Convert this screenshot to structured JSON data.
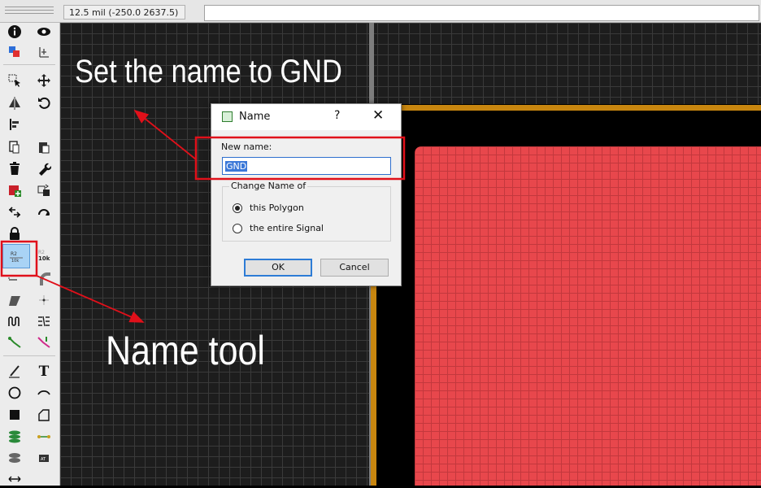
{
  "status": {
    "coordinate": "12.5 mil (-250.0 2637.5)"
  },
  "annotations": {
    "top_text": "Set the name to GND",
    "bottom_text": "Name tool",
    "color": "#e0101a"
  },
  "dialog": {
    "title": "Name",
    "help_glyph": "?",
    "close_glyph": "✕",
    "new_name_label": "New name:",
    "new_name_value": "GND",
    "group_title": "Change Name of",
    "options": [
      {
        "label": "this Polygon",
        "selected": true
      },
      {
        "label": "the entire Signal",
        "selected": false
      }
    ],
    "ok_label": "OK",
    "cancel_label": "Cancel"
  },
  "toolbar": {
    "icons": [
      "info-icon",
      "eye-icon",
      "layer-display-icon",
      "mark-icon",
      "select-icon",
      "move-icon",
      "mirror-icon",
      "rotate-icon",
      "align-icon",
      "copy-icon",
      "paste-icon",
      "delete-icon",
      "wrench-icon",
      "add-icon",
      "replace-icon",
      "swap-icon",
      "optimize-icon",
      "lock-icon",
      "name-tool-icon",
      "value-tool-icon",
      "smash-icon",
      "miter-icon",
      "split-icon",
      "meander-icon",
      "ripup-icon",
      "route-icon",
      "autoroute-icon",
      "line-icon",
      "text-icon",
      "circle-icon",
      "arc-icon",
      "rectangle-icon",
      "polygon-icon",
      "via-icon",
      "signal-icon",
      "hole-icon",
      "attribute-icon",
      "dimension-icon"
    ],
    "text_tool_glyph": "T",
    "value_tool_text": "10k"
  },
  "colors": {
    "copper": "#e8474c",
    "board_outline": "#c8860f",
    "canvas": "#1d1d1d"
  }
}
